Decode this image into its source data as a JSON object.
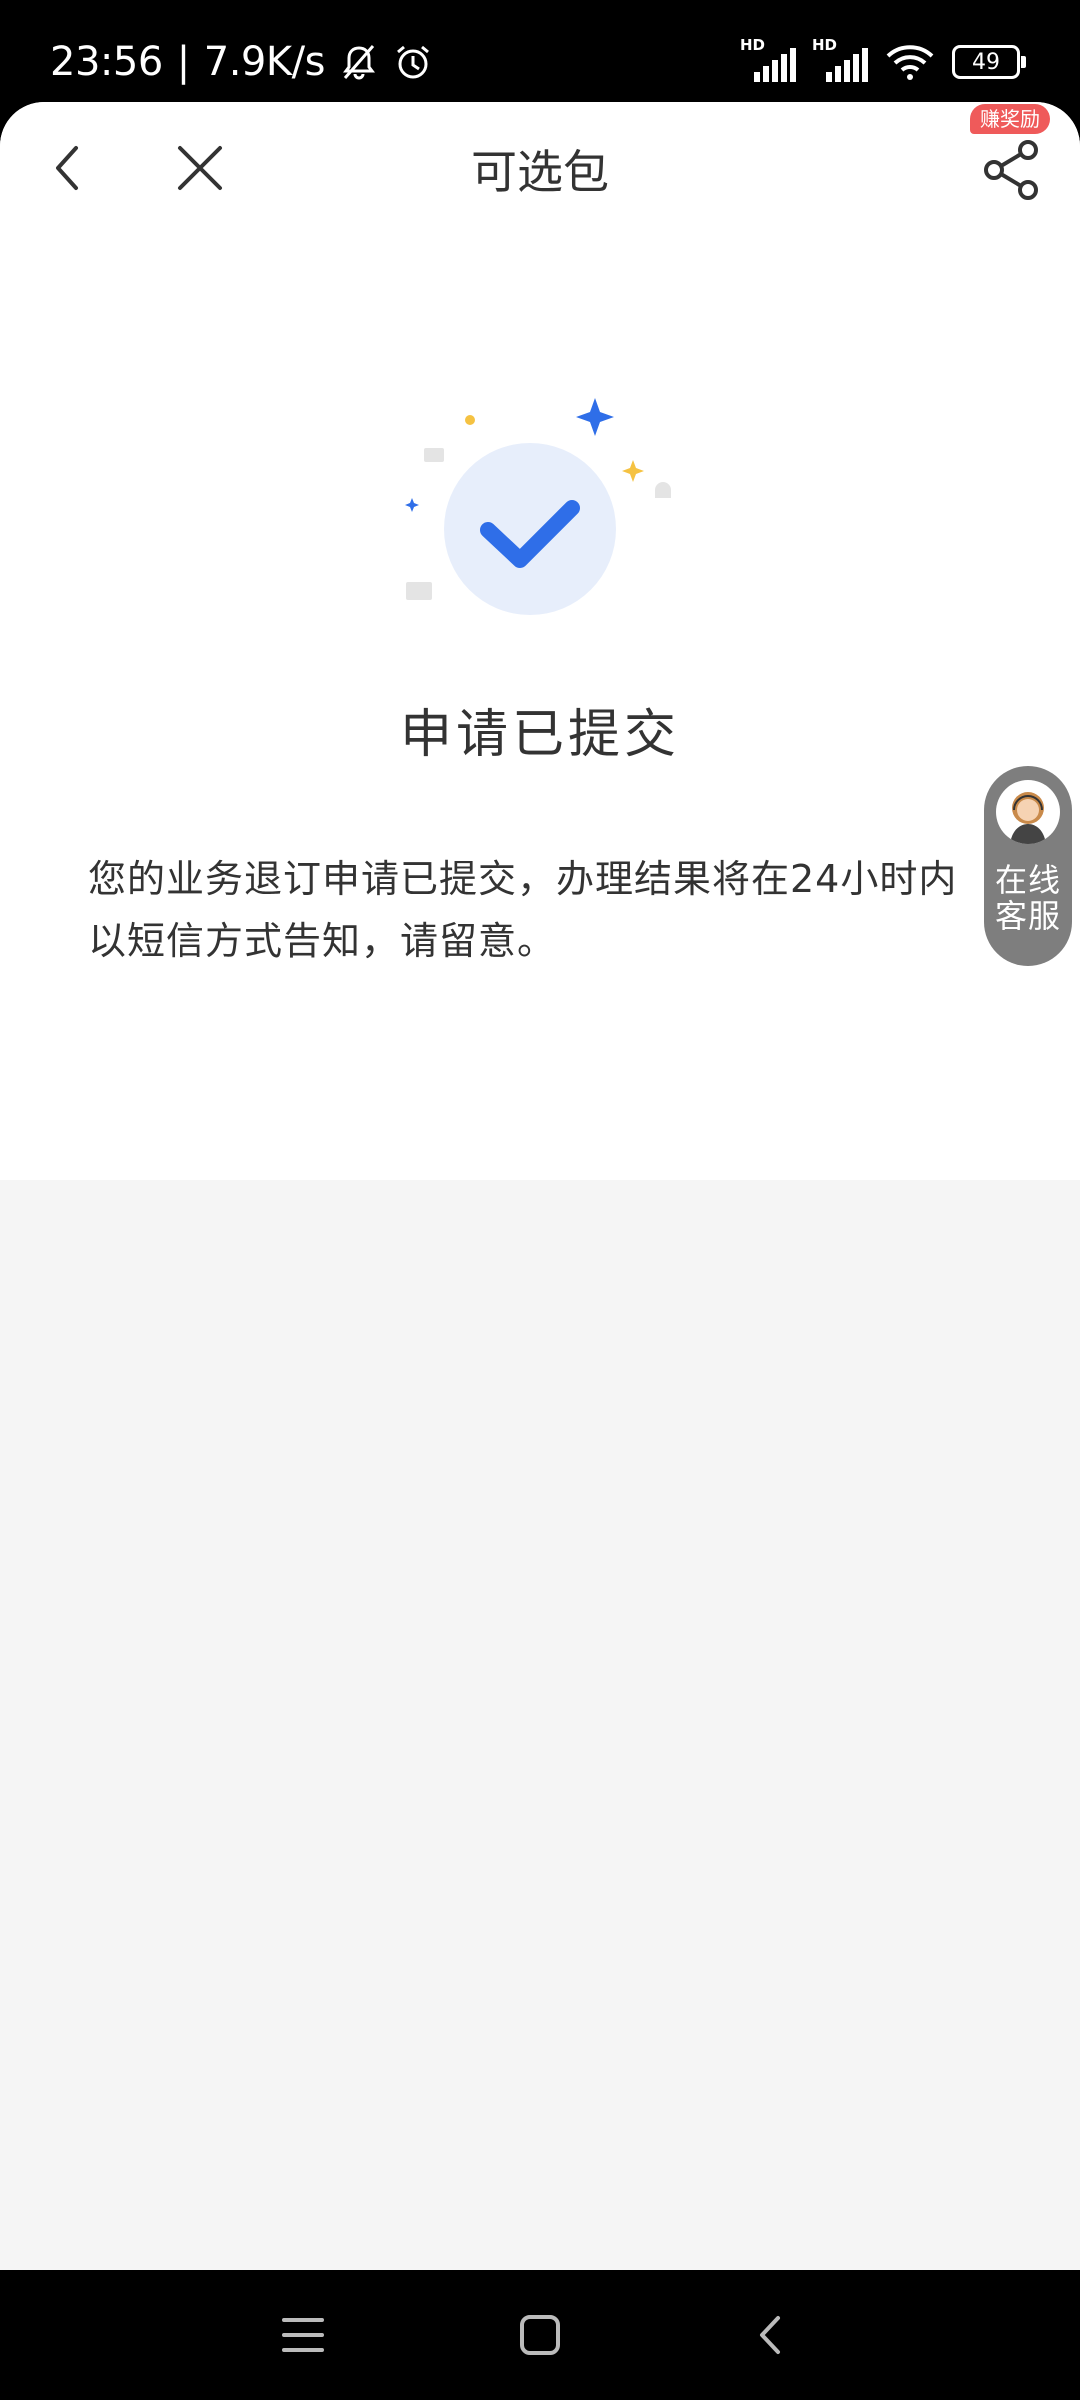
{
  "status_bar": {
    "time": "23:56",
    "separator": "|",
    "net_speed": "7.9K/s",
    "sim1_label": "HD",
    "sim2_label": "HD",
    "battery_level": "49",
    "icons": [
      "mute-bell-icon",
      "alarm-clock-icon",
      "signal-icon",
      "signal-icon",
      "wifi-icon",
      "battery-icon"
    ]
  },
  "nav": {
    "title": "可选包",
    "reward_badge": "赚奖励",
    "icons": [
      "back-arrow-icon",
      "close-icon",
      "share-icon"
    ]
  },
  "result": {
    "title": "申请已提交",
    "description": "您的业务退订申请已提交，办理结果将在24小时内以短信方式告知，请留意。",
    "icon": "checkmark-success-icon"
  },
  "service": {
    "label": "在线客服",
    "icon": "customer-service-avatar-icon"
  },
  "system_nav": {
    "icons": [
      "menu-icon",
      "home-icon",
      "back-icon"
    ]
  },
  "colors": {
    "accent": "#2f6ee8",
    "success_circle": "#e7eefb",
    "badge_red": "#ef5a5a",
    "sparkle_yellow": "#f5c242",
    "page_gray": "#f5f5f5"
  }
}
